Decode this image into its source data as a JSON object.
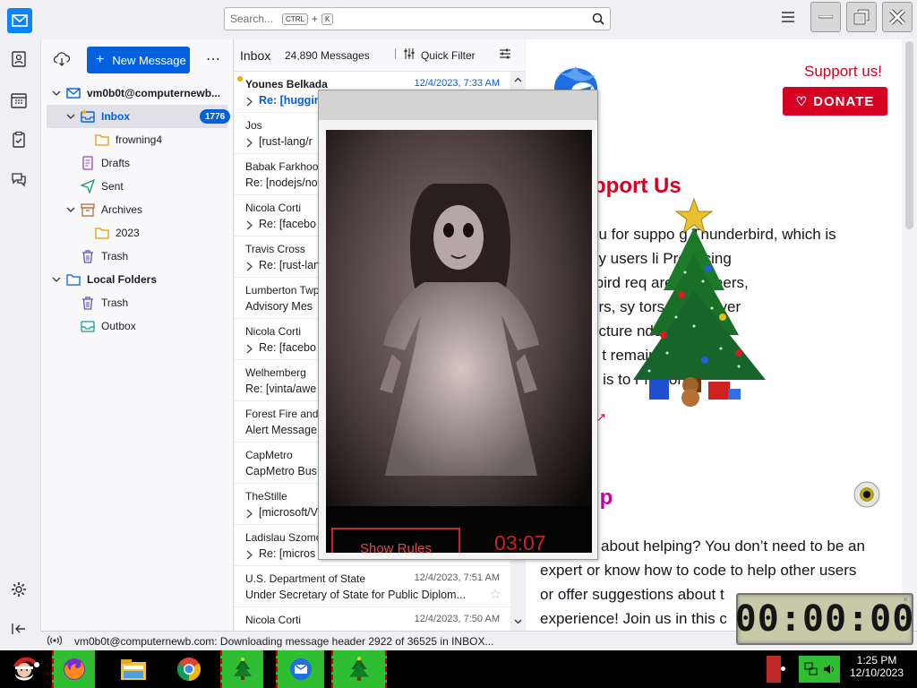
{
  "search": {
    "placeholder": "Search...",
    "key1": "CTRL",
    "plus": "+",
    "key2": "K"
  },
  "folders": {
    "new_message": "New Message",
    "items": [
      {
        "label": "vm0b0t@computernewb...",
        "bold": true
      },
      {
        "label": "Inbox",
        "badge": "1776"
      },
      {
        "label": "frowning4"
      },
      {
        "label": "Drafts"
      },
      {
        "label": "Sent"
      },
      {
        "label": "Archives"
      },
      {
        "label": "2023"
      },
      {
        "label": "Trash"
      },
      {
        "label": "Local Folders",
        "bold": true
      },
      {
        "label": "Trash"
      },
      {
        "label": "Outbox"
      }
    ]
  },
  "thread": {
    "folder": "Inbox",
    "count": "24,890 Messages",
    "quick_filter": "Quick Filter",
    "messages": [
      {
        "from": "Younes Belkada",
        "date": "12/4/2023, 7:33 AM",
        "subject": "Re: [huggin",
        "unread": true,
        "thread": true
      },
      {
        "from": "Jos",
        "date": "",
        "subject": "[rust-lang/r",
        "thread": true
      },
      {
        "from": "Babak Farkhoop",
        "date": "",
        "subject": "Re: [nodejs/no",
        "thread": false
      },
      {
        "from": "Nicola Corti",
        "date": "",
        "subject": "Re: [facebo",
        "thread": true
      },
      {
        "from": "Travis Cross",
        "date": "",
        "subject": "Re: [rust-lan",
        "thread": true
      },
      {
        "from": "Lumberton Twp",
        "date": "",
        "subject": "Advisory Mes",
        "thread": false
      },
      {
        "from": "Nicola Corti",
        "date": "",
        "subject": "Re: [facebo",
        "thread": true
      },
      {
        "from": "Welhemberg",
        "date": "",
        "subject": "Re: [vinta/awe",
        "thread": false
      },
      {
        "from": "Forest Fire and",
        "date": "",
        "subject": "Alert Message",
        "thread": false
      },
      {
        "from": "CapMetro",
        "date": "",
        "subject": "CapMetro Bus",
        "thread": false
      },
      {
        "from": "TheStille",
        "date": "",
        "subject": "[microsoft/V",
        "thread": true
      },
      {
        "from": "Ladislau Szomo",
        "date": "",
        "subject": "Re: [micros",
        "thread": true
      },
      {
        "from": "U.S. Department of State",
        "date": "12/4/2023, 7:51 AM",
        "subject": "Under Secretary of State for Public Diplom...",
        "thread": false,
        "star": true
      },
      {
        "from": "Nicola Corti",
        "date": "12/4/2023, 7:50 AM",
        "subject": "",
        "thread": false
      }
    ]
  },
  "content": {
    "support": "Support us!",
    "donate": "DONATE",
    "heading1": "pport Us",
    "para1": [
      "ou for suppo     g Thunderbird, which is",
      "by users li        Producing",
      "rbird req               are engineers,",
      "ers, sy               tors and server",
      "ucture             nderbird, the",
      "y t                          remains",
      "e is to r              nation."
    ],
    "heading2": "lp",
    "para2": [
      "about helping? You don’t need to be an",
      "expert or know how to code to help other users",
      "or offer suggestions about t",
      "experience! Join us in this c"
    ]
  },
  "popup": {
    "show_rules": "Show Rules",
    "timer": "03:07"
  },
  "status": {
    "text": "vm0b0t@computernewb.com: Downloading message header 2922 of 36525 in INBOX..."
  },
  "desktop_timer": "00:00:00",
  "taskbar": {
    "time": "1:25 PM",
    "date": "12/10/2023"
  },
  "colors": {
    "accent": "#0060df",
    "donate": "#d70022",
    "taskbar_green": "#2fbd31"
  }
}
